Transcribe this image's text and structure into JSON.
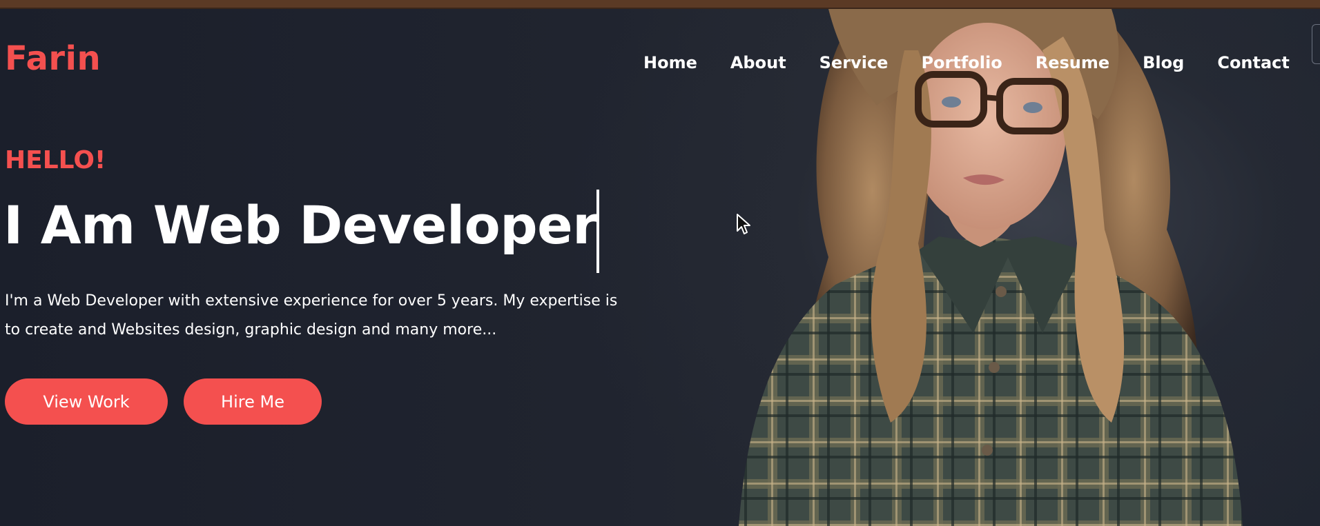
{
  "brand": {
    "logo_text": "Farin",
    "accent_color": "#f4504f"
  },
  "nav": {
    "items": [
      {
        "label": "Home"
      },
      {
        "label": "About"
      },
      {
        "label": "Service"
      },
      {
        "label": "Portfolio"
      },
      {
        "label": "Resume"
      },
      {
        "label": "Blog"
      },
      {
        "label": "Contact"
      }
    ]
  },
  "hero": {
    "greeting": "HELLO!",
    "headline": "I Am Web Developer",
    "description_line1": "I'm a Web Developer with extensive experience for over 5 years. My expertise is",
    "description_line2": "to create and Websites design, graphic design and many more...",
    "buttons": {
      "view_work": "View Work",
      "hire_me": "Hire Me"
    },
    "background_color": "#1e2230",
    "photo_icon": "portrait-photo"
  }
}
